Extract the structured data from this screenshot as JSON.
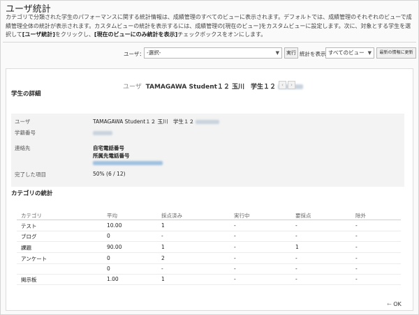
{
  "page": {
    "title": "ユーザ統計",
    "description_1": "カテゴリで分類された学生のパフォーマンスに関する統計情報は、成績管理のすべてのビューに表示されます。デフォルトでは、成績管理のそれぞれのビューで成績管理全体の統計が表示されます。カスタムビューの統計を表示するには、成績管理の[現在のビュー]をカスタムビューに設定します。次に、対象とする学生を選択して",
    "description_bold_1": "[ユーザ統計]",
    "description_2": "をクリックし、",
    "description_bold_2": "[現在のビューにのみ統計を表示]",
    "description_3": "チェックボックスをオンにします。"
  },
  "filters": {
    "user_label": "ユーザ：",
    "user_value": "-選択-",
    "run_button": "実行",
    "display_label": "統計を表示：",
    "display_value": "すべてのビュー",
    "refresh_button": "最新の情報に更新"
  },
  "navigator": {
    "user_label": "ユーザ",
    "student_name": "TAMAGAWA Student１２ 玉川　学生１２",
    "prev_icon": "chevron-left-icon",
    "next_icon": "chevron-right-icon"
  },
  "student_detail": {
    "section_title": "学生の詳細",
    "user_label": "ユーザ",
    "user_value": "TAMAGAWA Student１２ 玉川　学生１２",
    "student_id_label": "学籍番号",
    "contact_label": "連絡先",
    "home_phone": "自宅電話番号",
    "work_phone": "所属先電話番号",
    "completed_label": "完了した項目",
    "completed_value": "50% (6 / 12)"
  },
  "category_stats": {
    "section_title": "カテゴリの統計",
    "columns": [
      "カテゴリ",
      "平均",
      "採点済み",
      "実行中",
      "要採点",
      "除外"
    ],
    "rows": [
      [
        "テスト",
        "10.00",
        "1",
        "-",
        "-",
        "-"
      ],
      [
        "ブログ",
        "0",
        "-",
        "-",
        "-",
        "-"
      ],
      [
        "課題",
        "90.00",
        "1",
        "-",
        "1",
        "-"
      ],
      [
        "アンケート",
        "0",
        "2",
        "-",
        "-",
        "-"
      ],
      [
        "",
        "0",
        "-",
        "-",
        "-",
        "-"
      ],
      [
        "掲示板",
        "1.00",
        "1",
        "-",
        "-",
        "-"
      ]
    ]
  },
  "footer": {
    "ok_label": "OK"
  }
}
